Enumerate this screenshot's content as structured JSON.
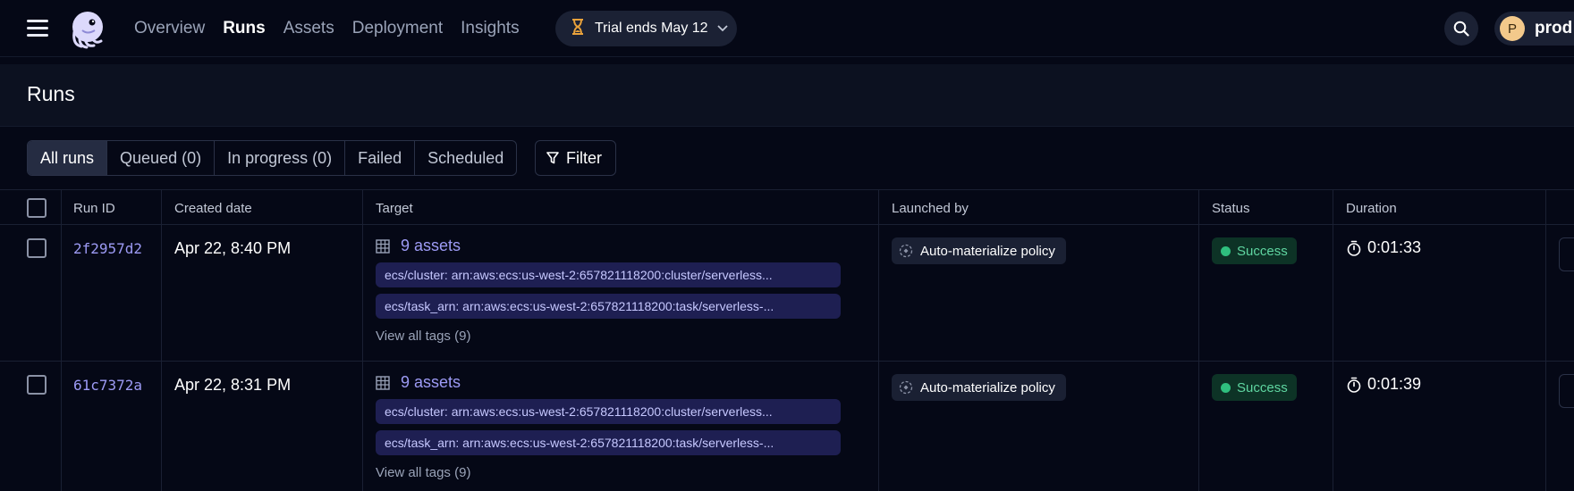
{
  "nav": {
    "links": [
      "Overview",
      "Runs",
      "Assets",
      "Deployment",
      "Insights"
    ],
    "active": "Runs",
    "trial_label": "Trial ends May 12",
    "profile_initial": "P",
    "profile_name": "prod"
  },
  "page": {
    "title": "Runs"
  },
  "tabs": [
    "All runs",
    "Queued (0)",
    "In progress (0)",
    "Failed",
    "Scheduled"
  ],
  "filter_label": "Filter",
  "table": {
    "headers": {
      "run_id": "Run ID",
      "created": "Created date",
      "target": "Target",
      "launched_by": "Launched by",
      "status": "Status",
      "duration": "Duration"
    },
    "rows": [
      {
        "run_id": "2f2957d2",
        "created": "Apr 22, 8:40 PM",
        "assets": "9 assets",
        "tag1": "ecs/cluster: arn:aws:ecs:us-west-2:657821118200:cluster/serverless...",
        "tag2": "ecs/task_arn: arn:aws:ecs:us-west-2:657821118200:task/serverless-...",
        "view_tags": "View all tags (9)",
        "launched_by": "Auto-materialize policy",
        "status": "Success",
        "duration": "0:01:33"
      },
      {
        "run_id": "61c7372a",
        "created": "Apr 22, 8:31 PM",
        "assets": "9 assets",
        "tag1": "ecs/cluster: arn:aws:ecs:us-west-2:657821118200:cluster/serverless...",
        "tag2": "ecs/task_arn: arn:aws:ecs:us-west-2:657821118200:task/serverless-...",
        "view_tags": "View all tags (9)",
        "launched_by": "Auto-materialize policy",
        "status": "Success",
        "duration": "0:01:39"
      }
    ]
  },
  "icons": {
    "menu": "menu-icon",
    "logo": "dagster-logo",
    "trial": "hourglass-icon",
    "search": "search-icon",
    "filter": "filter-icon",
    "assets": "table-icon",
    "launched": "auto-materialize-icon",
    "duration": "stopwatch-icon"
  },
  "colors": {
    "background": "#050816",
    "accent": "#9d9bf5",
    "success": "#2fbf7e",
    "tag_bg": "#1e1f52"
  }
}
